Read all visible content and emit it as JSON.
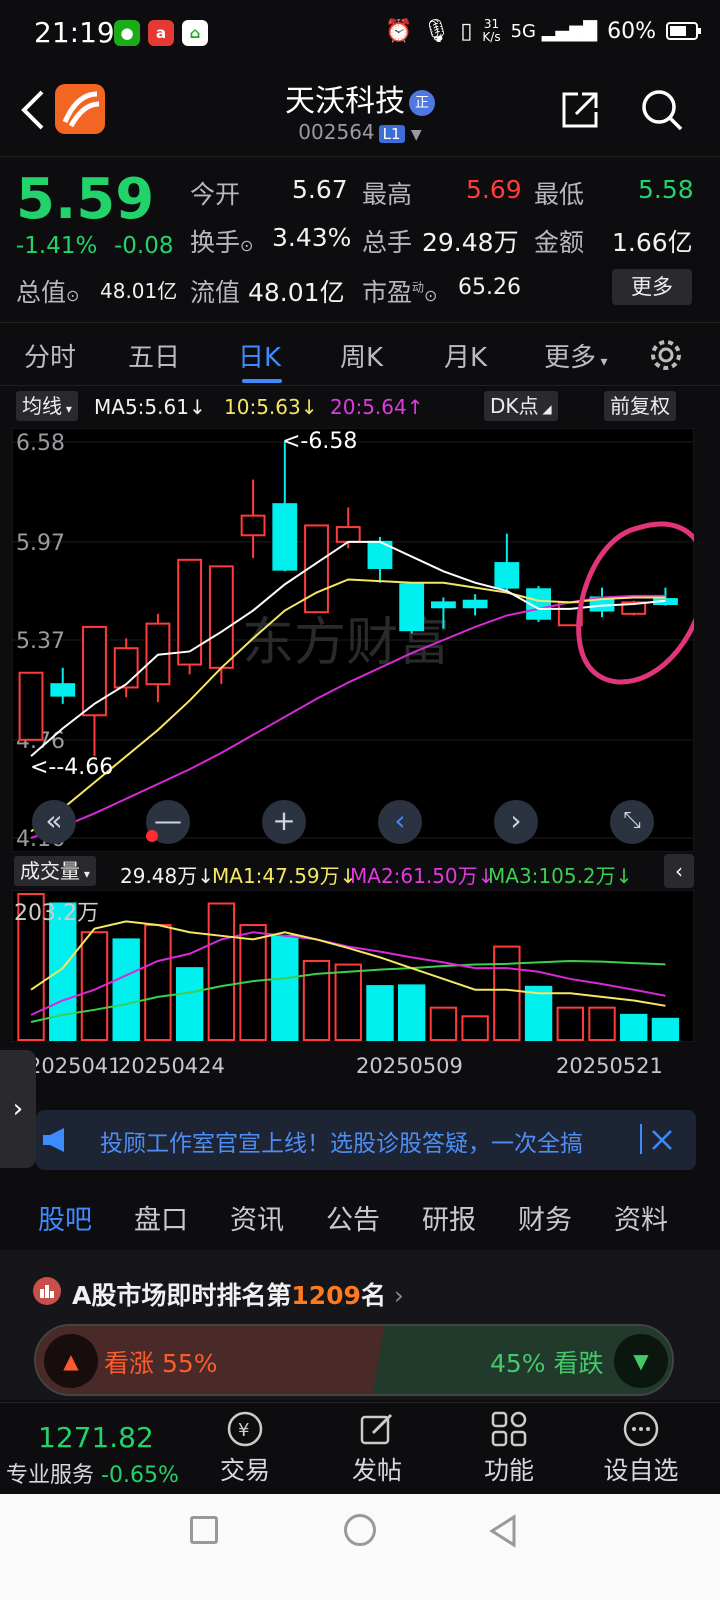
{
  "status_bar": {
    "time": "21:19",
    "net_speed_top": "31",
    "net_speed_bottom": "K/s",
    "battery": "60%"
  },
  "header": {
    "stock_name": "天沃科技",
    "badge": "正",
    "code": "002564",
    "level": "L1"
  },
  "quote": {
    "price": "5.59",
    "change_pct": "-1.41%",
    "change": "-0.08",
    "rows": [
      [
        {
          "label": "今开",
          "value": "5.67",
          "color": "white"
        },
        {
          "label": "最高",
          "value": "5.69",
          "color": "red"
        },
        {
          "label": "最低",
          "value": "5.58",
          "color": "green"
        }
      ],
      [
        {
          "label": "换手",
          "value": "3.43%",
          "color": "white"
        },
        {
          "label": "总手",
          "value": "29.48万",
          "color": "white"
        },
        {
          "label": "金额",
          "value": "1.66亿",
          "color": "white"
        }
      ]
    ],
    "market_cap_label": "总值",
    "market_cap": "48.01亿",
    "float_cap_label": "流值",
    "float_cap": "48.01亿",
    "pe_label": "市盈",
    "pe_sup": "动",
    "pe": "65.26",
    "more": "更多"
  },
  "period_tabs": [
    "分时",
    "五日",
    "日K",
    "周K",
    "月K",
    "更多"
  ],
  "active_period": "日K",
  "ma_legend": {
    "toggle": "均线",
    "ma5": "MA5:5.61",
    "ma10": "10:5.63",
    "ma20": "20:5.64",
    "dk": "DK点",
    "adjust": "前复权"
  },
  "kline": {
    "y_labels": [
      "6.58",
      "5.97",
      "5.37",
      "4.76",
      "4.16"
    ],
    "high_marker": "<-6.58",
    "low_marker": "<--4.66",
    "watermark": "东方财富",
    "colors": {
      "up": "#ff3b3b",
      "down": "#00f0f0",
      "ma5": "#ffffff",
      "ma10": "#f5e663",
      "ma20": "#d62ad6",
      "circle": "#e0357a"
    },
    "chart_data": {
      "type": "candlestick",
      "ylim": [
        4.16,
        6.58
      ],
      "candles": [
        {
          "o": 4.76,
          "c": 5.17,
          "h": 5.17,
          "l": 4.76
        },
        {
          "o": 5.1,
          "c": 5.03,
          "h": 5.2,
          "l": 4.98
        },
        {
          "o": 4.91,
          "c": 5.45,
          "h": 5.45,
          "l": 4.66
        },
        {
          "o": 5.08,
          "c": 5.32,
          "h": 5.38,
          "l": 5.02
        },
        {
          "o": 5.1,
          "c": 5.47,
          "h": 5.53,
          "l": 4.99
        },
        {
          "o": 5.22,
          "c": 5.86,
          "h": 5.86,
          "l": 5.16
        },
        {
          "o": 5.2,
          "c": 5.82,
          "h": 5.82,
          "l": 5.1
        },
        {
          "o": 6.01,
          "c": 6.13,
          "h": 6.35,
          "l": 5.87
        },
        {
          "o": 6.2,
          "c": 5.8,
          "h": 6.58,
          "l": 5.79
        },
        {
          "o": 5.54,
          "c": 6.07,
          "h": 6.07,
          "l": 5.54
        },
        {
          "o": 5.97,
          "c": 6.06,
          "h": 6.18,
          "l": 5.93
        },
        {
          "o": 5.97,
          "c": 5.81,
          "h": 6.0,
          "l": 5.72
        },
        {
          "o": 5.71,
          "c": 5.43,
          "h": 5.71,
          "l": 5.41
        },
        {
          "o": 5.6,
          "c": 5.57,
          "h": 5.63,
          "l": 5.44
        },
        {
          "o": 5.61,
          "c": 5.57,
          "h": 5.65,
          "l": 5.52
        },
        {
          "o": 5.84,
          "c": 5.69,
          "h": 6.02,
          "l": 5.67
        },
        {
          "o": 5.68,
          "c": 5.5,
          "h": 5.7,
          "l": 5.48
        },
        {
          "o": 5.46,
          "c": 5.6,
          "h": 5.6,
          "l": 5.46
        },
        {
          "o": 5.63,
          "c": 5.55,
          "h": 5.69,
          "l": 5.51
        },
        {
          "o": 5.53,
          "c": 5.6,
          "h": 5.61,
          "l": 5.52
        },
        {
          "o": 5.62,
          "c": 5.59,
          "h": 5.69,
          "l": 5.58
        }
      ],
      "ma5": [
        4.66,
        4.83,
        4.98,
        5.1,
        5.28,
        5.3,
        5.42,
        5.55,
        5.71,
        5.84,
        5.97,
        5.97,
        5.88,
        5.79,
        5.72,
        5.67,
        5.56,
        5.56,
        5.58,
        5.59,
        5.61
      ],
      "ma10": [
        4.2,
        4.34,
        4.5,
        4.66,
        4.82,
        5.0,
        5.2,
        5.38,
        5.55,
        5.66,
        5.74,
        5.73,
        5.72,
        5.72,
        5.69,
        5.66,
        5.61,
        5.6,
        5.62,
        5.63,
        5.63
      ],
      "ma20": [
        4.16,
        4.23,
        4.31,
        4.4,
        4.49,
        4.58,
        4.68,
        4.79,
        4.9,
        5.01,
        5.11,
        5.2,
        5.29,
        5.37,
        5.45,
        5.52,
        5.56,
        5.6,
        5.63,
        5.64,
        5.64
      ]
    }
  },
  "volume": {
    "label": "成交量",
    "vol": "29.48万",
    "ma1": "MA1:47.59万",
    "ma2": "MA2:61.50万",
    "ma3": "MA3:105.2万",
    "y_max_label": "203.2万",
    "colors": {
      "ma1": "#f5e663",
      "ma2": "#d62ad6",
      "ma3": "#3ccf4e"
    },
    "chart_data": {
      "type": "bar",
      "ylim": [
        0,
        203.2
      ],
      "values": [
        203.2,
        190,
        150,
        140,
        160,
        100,
        190,
        160,
        145,
        110,
        105,
        75,
        76,
        45,
        33,
        130,
        74,
        45,
        45,
        35,
        29.48
      ],
      "up": [
        true,
        false,
        true,
        false,
        true,
        false,
        true,
        true,
        false,
        true,
        true,
        false,
        false,
        true,
        true,
        true,
        false,
        true,
        true,
        false,
        false
      ],
      "ma1": [
        70,
        100,
        155,
        165,
        160,
        150,
        145,
        140,
        150,
        140,
        128,
        115,
        100,
        85,
        70,
        70,
        65,
        65,
        60,
        55,
        47.59
      ],
      "ma2": [
        35,
        55,
        70,
        90,
        110,
        120,
        140,
        150,
        145,
        140,
        130,
        123,
        115,
        108,
        100,
        100,
        95,
        85,
        78,
        70,
        61.5
      ],
      "ma3": [
        25,
        35,
        42,
        50,
        60,
        66,
        75,
        82,
        86,
        92,
        95,
        98,
        100,
        103,
        105,
        106,
        108,
        110,
        109,
        107,
        105.2
      ]
    }
  },
  "dates": [
    "20250418",
    "20250424",
    "20250509",
    "20250521"
  ],
  "notice": "投顾工作室官宣上线！选股诊股答疑，一次全搞",
  "section_tabs": [
    "股吧",
    "盘口",
    "资讯",
    "公告",
    "研报",
    "财务",
    "资料"
  ],
  "rank": {
    "prefix": "A股市场即时排名第",
    "number": "1209",
    "suffix": "名",
    "bull_label": "看涨",
    "bull_pct": "55%",
    "bear_pct": "45%",
    "bear_label": "看跌"
  },
  "bottom_nav": {
    "index_value": "1271.82",
    "index_label": "专业服务",
    "index_change": "-0.65%",
    "items": [
      "交易",
      "发帖",
      "功能",
      "设自选"
    ]
  }
}
